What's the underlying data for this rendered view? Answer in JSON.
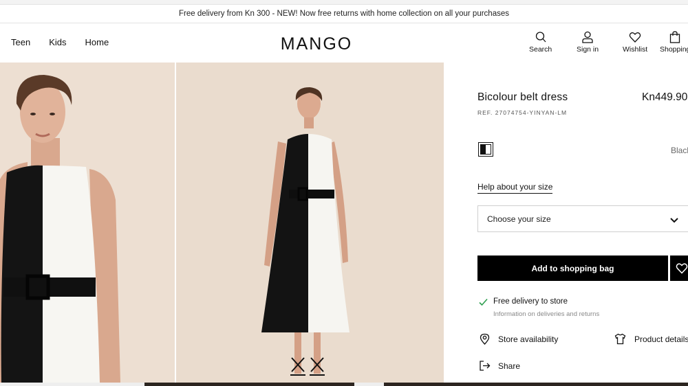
{
  "promo": {
    "text": "Free delivery from Kn 300 - NEW! Now free returns with home collection on all your purchases"
  },
  "nav": {
    "items": [
      "Teen",
      "Kids",
      "Home"
    ]
  },
  "brand": {
    "logo_text": "MANGO"
  },
  "tools": {
    "search": "Search",
    "signin": "Sign in",
    "wishlist": "Wishlist",
    "shopping": "Shopping"
  },
  "product": {
    "title": "Bicolour belt dress",
    "price": "Kn449.90",
    "ref": "REF. 27074754-YINYAN-LM",
    "color_name": "Black",
    "help_size": "Help about your size",
    "size_placeholder": "Choose your size",
    "add_to_bag": "Add to shopping bag"
  },
  "delivery": {
    "title": "Free delivery to store",
    "subtitle": "Information on deliveries and returns"
  },
  "actions": {
    "store_availability": "Store availability",
    "product_details": "Product details",
    "share": "Share"
  },
  "colors": {
    "accent_black": "#000000",
    "check_green": "#2e9e4f",
    "photo_background": "#eadcce"
  },
  "icons": [
    "search-icon",
    "user-icon",
    "heart-icon",
    "bag-icon",
    "chevron-down-icon",
    "checkmark-icon",
    "location-pin-icon",
    "tshirt-icon",
    "share-icon"
  ]
}
